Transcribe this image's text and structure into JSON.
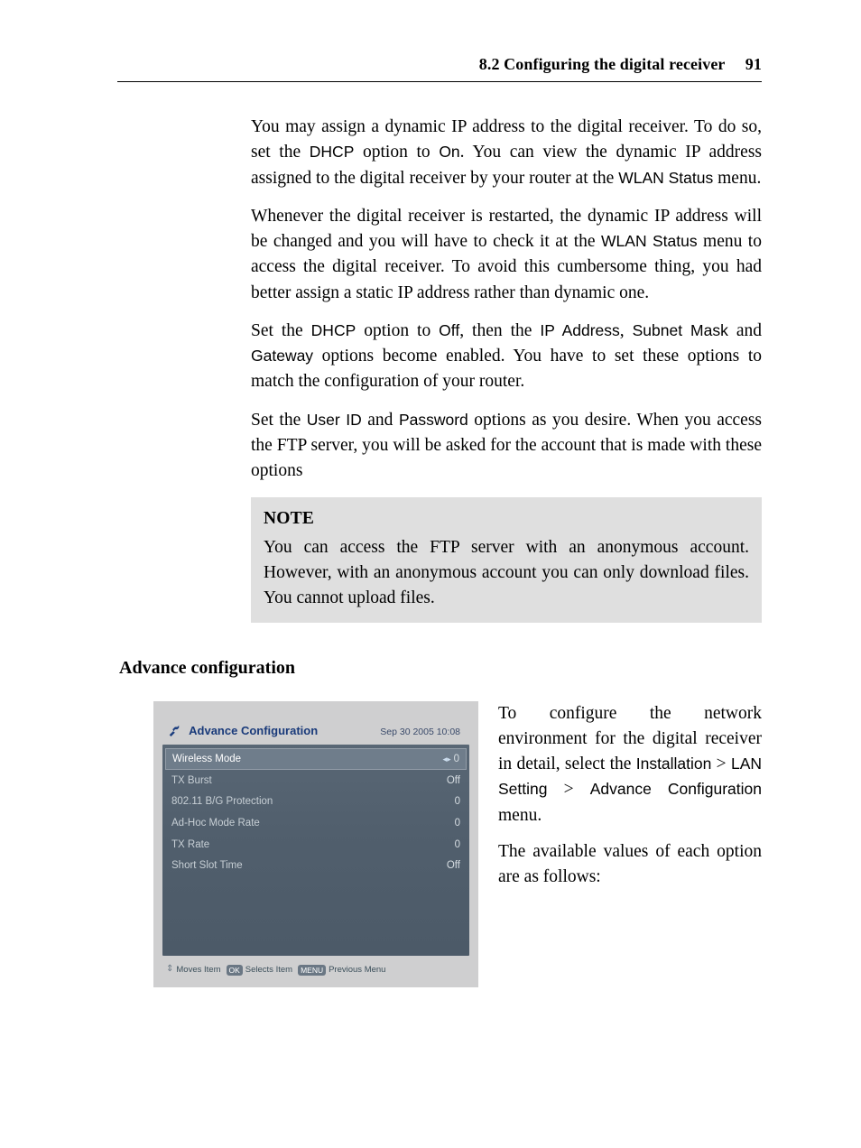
{
  "header": {
    "section": "8.2 Configuring the digital receiver",
    "page_number": "91"
  },
  "paragraphs": {
    "p1_a": "You may assign a dynamic IP address to the digital receiver. To do so, set the ",
    "p1_b": " option to ",
    "p1_c": ". You can view the dynamic IP address assigned to the digital receiver by your router at the ",
    "p1_d": " menu.",
    "p2_a": "Whenever the digital receiver is restarted, the dynamic IP address will be changed and you will have to check it at the ",
    "p2_b": " menu to access the digital receiver. To avoid this cumbersome thing, you had better assign a static IP address rather than dynamic one.",
    "p3_a": "Set the ",
    "p3_b": " option to ",
    "p3_c": ", then the ",
    "p3_d": ", ",
    "p3_e": " and ",
    "p3_f": " options become enabled. You have to set these options to match the configuration of your router.",
    "p4_a": "Set the ",
    "p4_b": " and ",
    "p4_c": " options as you desire. When you access the FTP server, you will be asked for the account that is made with these options"
  },
  "terms": {
    "DHCP": "DHCP",
    "On": "On",
    "Off": "Off",
    "WLAN_Status": "WLAN Status",
    "IP_Address": "IP Address",
    "Subnet_Mask": "Subnet Mask",
    "Gateway": "Gateway",
    "User_ID": "User ID",
    "Password": "Password",
    "Installation": "Installation",
    "LAN_Setting": "LAN Setting",
    "Advance_Configuration": "Advance Configuration"
  },
  "note": {
    "title": "NOTE",
    "body": "You can access the FTP server with an anonymous account. However, with an anonymous account you can only download files. You cannot upload files."
  },
  "subhead": "Advance configuration",
  "right_col": {
    "p1_a": "To configure the network environment for the digital receiver in detail, select the ",
    "p1_b": " > ",
    "p1_c": " > ",
    "p1_d": " menu.",
    "p2": "The available values of each option are as follows:"
  },
  "screenshot": {
    "title": "Advance Configuration",
    "date": "Sep 30 2005 10:08",
    "rows": [
      {
        "label": "Wireless Mode",
        "value": "0",
        "highlight": true
      },
      {
        "label": "TX Burst",
        "value": "Off"
      },
      {
        "label": "802.11 B/G Protection",
        "value": "0"
      },
      {
        "label": "Ad-Hoc Mode Rate",
        "value": "0"
      },
      {
        "label": "TX Rate",
        "value": "0"
      },
      {
        "label": "Short Slot Time",
        "value": "Off"
      }
    ],
    "hints": {
      "moves": "Moves Item",
      "ok_chip": "OK",
      "selects": "Selects Item",
      "menu_chip": "MENU",
      "previous": "Previous Menu"
    }
  }
}
